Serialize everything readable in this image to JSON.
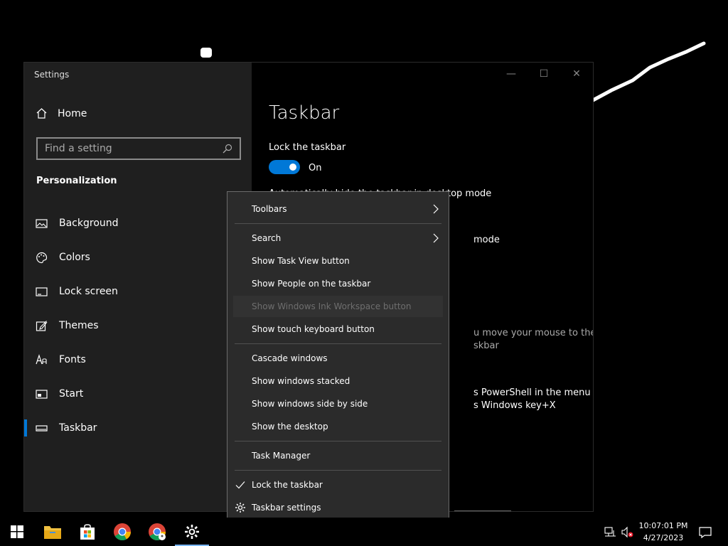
{
  "window": {
    "title": "Settings",
    "controls": {
      "minimize": "—",
      "maximize": "☐",
      "close": "✕"
    }
  },
  "sidebar": {
    "home": "Home",
    "search": {
      "placeholder": "Find a setting"
    },
    "section": "Personalization",
    "items": [
      {
        "label": "Background",
        "icon": "image-icon"
      },
      {
        "label": "Colors",
        "icon": "palette-icon"
      },
      {
        "label": "Lock screen",
        "icon": "lock-screen-icon"
      },
      {
        "label": "Themes",
        "icon": "brush-icon"
      },
      {
        "label": "Fonts",
        "icon": "fonts-icon"
      },
      {
        "label": "Start",
        "icon": "start-icon"
      },
      {
        "label": "Taskbar",
        "icon": "taskbar-icon",
        "active": true
      }
    ]
  },
  "content": {
    "title": "Taskbar",
    "lock_label": "Lock the taskbar",
    "lock_state": "On",
    "behind_texts": [
      "Automatically hide the taskbar in desktop mode",
      "mode",
      "u move your mouse to the",
      "skbar",
      "s PowerShell in the menu",
      "s Windows key+X"
    ]
  },
  "context_menu": {
    "toolbars": "Toolbars",
    "search": "Search",
    "task_view": "Show Task View button",
    "people": "Show People on the taskbar",
    "ink": "Show Windows Ink Workspace button",
    "touch_keyboard": "Show touch keyboard button",
    "cascade": "Cascade windows",
    "stacked": "Show windows stacked",
    "side_by_side": "Show windows side by side",
    "desktop": "Show the desktop",
    "task_manager": "Task Manager",
    "lock": "Lock the taskbar",
    "settings": "Taskbar settings"
  },
  "taskbar": {
    "time": "10:07:01 PM",
    "date": "4/27/2023",
    "apps": [
      "start-icon",
      "file-explorer-icon",
      "store-icon",
      "chrome-icon",
      "chrome-icon",
      "settings-gear-icon"
    ]
  },
  "colors": {
    "accent": "#0078d7",
    "menu_bg": "#2b2b2b",
    "sidebar_bg": "#1f1f1f"
  }
}
